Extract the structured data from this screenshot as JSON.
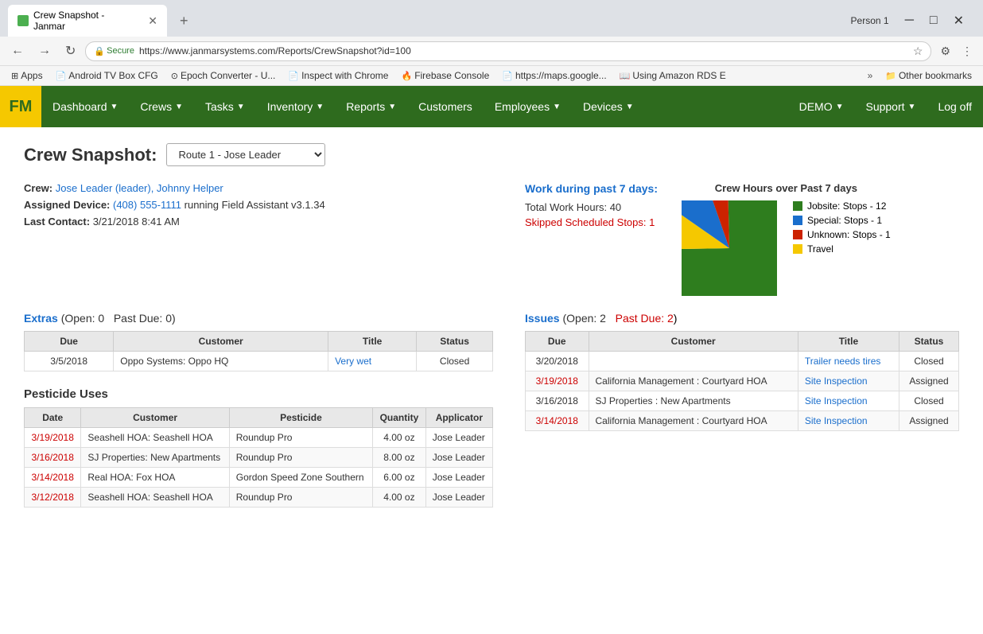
{
  "browser": {
    "tab_title": "Crew Snapshot - Janmar",
    "address": "https://www.janmarsystems.com/Reports/CrewSnapshot?id=100",
    "secure_text": "Secure",
    "person_label": "Person 1",
    "bookmarks": [
      {
        "label": "Apps",
        "icon": "⊞"
      },
      {
        "label": "Android TV Box CFG",
        "icon": "📄"
      },
      {
        "label": "Epoch Converter - U...",
        "icon": "⊙"
      },
      {
        "label": "Inspect with Chrome",
        "icon": "📄"
      },
      {
        "label": "Firebase Console",
        "icon": "🔥"
      },
      {
        "label": "https://maps.google...",
        "icon": "📄"
      },
      {
        "label": "Using Amazon RDS E",
        "icon": "📖"
      },
      {
        "label": "Other bookmarks",
        "icon": "📁"
      }
    ]
  },
  "nav": {
    "logo_text": "FM",
    "items": [
      {
        "label": "Dashboard",
        "has_arrow": true
      },
      {
        "label": "Crews",
        "has_arrow": true
      },
      {
        "label": "Tasks",
        "has_arrow": true
      },
      {
        "label": "Inventory",
        "has_arrow": true
      },
      {
        "label": "Reports",
        "has_arrow": true
      },
      {
        "label": "Customers",
        "has_arrow": false
      },
      {
        "label": "Employees",
        "has_arrow": true
      },
      {
        "label": "Devices",
        "has_arrow": true
      }
    ],
    "right_items": [
      {
        "label": "DEMO",
        "has_arrow": true
      },
      {
        "label": "Support",
        "has_arrow": true
      },
      {
        "label": "Log off",
        "has_arrow": false
      }
    ]
  },
  "page": {
    "title": "Crew Snapshot:",
    "route_value": "Route 1 - Jose Leader",
    "crew_label": "Crew:",
    "crew_value": "Jose Leader (leader), Johnny Helper",
    "device_label": "Assigned Device:",
    "device_phone": "(408) 555-1111",
    "device_text": " running Field Assistant v3.1.34",
    "contact_label": "Last Contact:",
    "contact_value": "3/21/2018 8:41 AM"
  },
  "work_summary": {
    "title": "Work during past 7 days:",
    "total_hours_label": "Total Work Hours:",
    "total_hours": "40",
    "skipped_label": "Skipped Scheduled Stops:",
    "skipped_value": "1"
  },
  "chart": {
    "title": "Crew Hours over Past 7 days",
    "slices": [
      {
        "label": "Jobsite: Stops - 12",
        "color": "#2e7d1e",
        "percent": 75
      },
      {
        "label": "Special: Stops - 1",
        "color": "#1a6ecc",
        "percent": 10
      },
      {
        "label": "Unknown: Stops - 1",
        "color": "#cc2200",
        "percent": 5
      },
      {
        "label": "Travel",
        "color": "#f5c800",
        "percent": 10
      }
    ]
  },
  "extras": {
    "section_title": "Extras",
    "open_label": "Open:",
    "open_value": "0",
    "past_due_label": "Past Due:",
    "past_due_value": "0",
    "columns": [
      "Due",
      "Customer",
      "Title",
      "Status"
    ],
    "rows": [
      {
        "due": "3/5/2018",
        "due_alert": false,
        "customer": "Oppo Systems: Oppo HQ",
        "title": "Very wet",
        "title_link": true,
        "status": "Closed"
      }
    ]
  },
  "issues": {
    "section_title": "Issues",
    "open_label": "Open:",
    "open_value": "2",
    "past_due_label": "Past Due:",
    "past_due_value": "2",
    "columns": [
      "Due",
      "Customer",
      "Title",
      "Status"
    ],
    "rows": [
      {
        "due": "3/20/2018",
        "due_alert": false,
        "customer": "",
        "title": "Trailer needs tires",
        "title_link": true,
        "status": "Closed"
      },
      {
        "due": "3/19/2018",
        "due_alert": true,
        "customer": "California Management : Courtyard HOA",
        "title": "Site Inspection",
        "title_link": true,
        "status": "Assigned"
      },
      {
        "due": "3/16/2018",
        "due_alert": false,
        "customer": "SJ Properties : New Apartments",
        "title": "Site Inspection",
        "title_link": true,
        "status": "Closed"
      },
      {
        "due": "3/14/2018",
        "due_alert": true,
        "customer": "California Management : Courtyard HOA",
        "title": "Site Inspection",
        "title_link": true,
        "status": "Assigned"
      }
    ]
  },
  "pesticide": {
    "section_title": "Pesticide Uses",
    "columns": [
      "Date",
      "Customer",
      "Pesticide",
      "Quantity",
      "Applicator"
    ],
    "rows": [
      {
        "date": "3/19/2018",
        "date_alert": true,
        "customer": "Seashell HOA: Seashell HOA",
        "pesticide": "Roundup Pro",
        "quantity": "4.00 oz",
        "applicator": "Jose Leader"
      },
      {
        "date": "3/16/2018",
        "date_alert": true,
        "customer": "SJ Properties: New Apartments",
        "pesticide": "Roundup Pro",
        "quantity": "8.00 oz",
        "applicator": "Jose Leader"
      },
      {
        "date": "3/14/2018",
        "date_alert": true,
        "customer": "Real HOA: Fox HOA",
        "pesticide": "Gordon Speed Zone Southern",
        "quantity": "6.00 oz",
        "applicator": "Jose Leader"
      },
      {
        "date": "3/12/2018",
        "date_alert": true,
        "customer": "Seashell HOA: Seashell HOA",
        "pesticide": "Roundup Pro",
        "quantity": "4.00 oz",
        "applicator": "Jose Leader"
      }
    ]
  }
}
